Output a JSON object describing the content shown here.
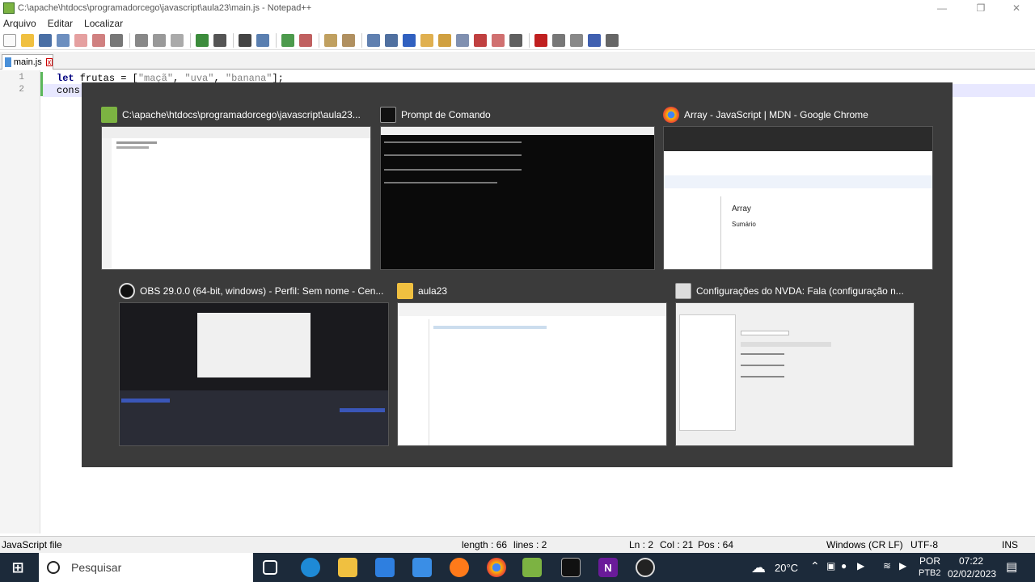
{
  "window": {
    "title": "C:\\apache\\htdocs\\programadorcego\\javascript\\aula23\\main.js - Notepad++"
  },
  "menu": [
    "Arquivo",
    "Editar",
    "Localizar"
  ],
  "tab": {
    "label": "main.js"
  },
  "editor": {
    "line_numbers": [
      "1",
      "2"
    ],
    "line1": {
      "kw": "let",
      "ident": " frutas = [",
      "s1": "\"maçã\"",
      "c1": ", ",
      "s2": "\"uva\"",
      "c2": ", ",
      "s3": "\"banana\"",
      "end": "];"
    },
    "line2": {
      "text": "cons"
    }
  },
  "switcher": {
    "items": [
      {
        "title": "C:\\apache\\htdocs\\programadorcego\\javascript\\aula23...",
        "icon": "notepadpp-icon",
        "color": "#7cb342"
      },
      {
        "title": "Prompt de Comando",
        "icon": "cmd-icon",
        "color": "#222222"
      },
      {
        "title": "Array - JavaScript | MDN - Google Chrome",
        "icon": "chrome-icon",
        "color": "#e8453c"
      },
      {
        "title": "OBS 29.0.0 (64-bit, windows) - Perfil: Sem nome - Cen...",
        "icon": "obs-icon",
        "color": "#111111"
      },
      {
        "title": "aula23",
        "icon": "folder-icon",
        "color": "#f0c040"
      },
      {
        "title": "Configurações do NVDA: Fala (configuração n...",
        "icon": "nvda-settings-icon",
        "color": "#dddddd"
      }
    ],
    "mdn": {
      "heading": "Array",
      "subheading": "Sumário"
    }
  },
  "status": {
    "filetype": "JavaScript file",
    "length": "length : 66",
    "lines": "lines : 2",
    "ln": "Ln : 2",
    "col": "Col : 21",
    "pos": "Pos : 64",
    "eol": "Windows (CR LF)",
    "encoding": "UTF-8",
    "mode": "INS"
  },
  "taskbar": {
    "search_placeholder": "Pesquisar",
    "temperature": "20°C",
    "lang1": "POR",
    "lang2": "PTB2",
    "time": "07:22",
    "date": "02/02/2023"
  },
  "colors": {
    "switcher_bg": "#3b3b3b",
    "taskbar_bg": "#1c2a3a",
    "accent": "#0078d4"
  }
}
